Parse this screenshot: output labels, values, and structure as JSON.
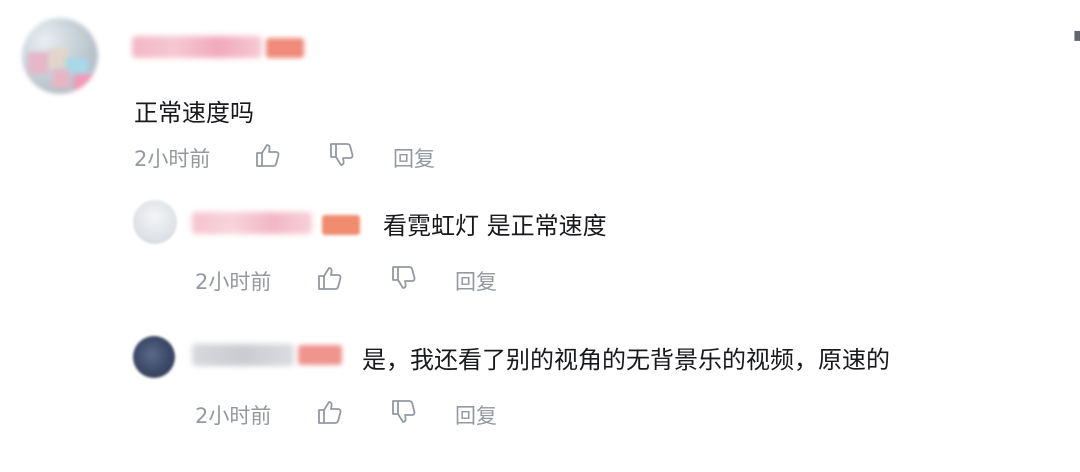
{
  "comments": {
    "main": {
      "text": "正常速度吗",
      "time": "2小时前",
      "reply_label": "回复"
    },
    "reply1": {
      "text": "看霓虹灯 是正常速度",
      "time": "2小时前",
      "reply_label": "回复"
    },
    "reply2": {
      "text": "是，我还看了别的视角的无背景乐的视频，原速的",
      "time": "2小时前",
      "reply_label": "回复"
    }
  },
  "colors": {
    "text": "#18191c",
    "meta": "#9499a0"
  },
  "icons": {
    "like": "thumbs-up-icon",
    "dislike": "thumbs-down-icon"
  }
}
